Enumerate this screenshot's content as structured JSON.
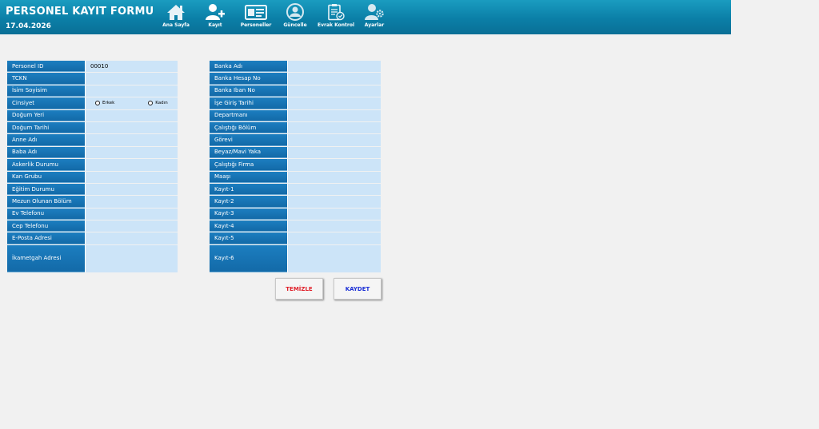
{
  "header": {
    "title": "PERSONEL KAYIT FORMU",
    "date": "17.04.2026",
    "nav": [
      {
        "label": "Ana Sayfa",
        "icon": "home-icon"
      },
      {
        "label": "Kayıt",
        "icon": "add-user-icon"
      },
      {
        "label": "Personeller",
        "icon": "id-card-icon"
      },
      {
        "label": "Güncelle",
        "icon": "user-refresh-icon"
      },
      {
        "label": "Evrak Kontrol",
        "icon": "clipboard-check-icon"
      },
      {
        "label": "Ayarlar",
        "icon": "user-settings-icon"
      }
    ]
  },
  "left_form": {
    "fields": [
      {
        "label": "Personel ID",
        "value": "00010"
      },
      {
        "label": "TCKN",
        "value": ""
      },
      {
        "label": "İsim Soyisim",
        "value": ""
      },
      {
        "label": "Cinsiyet",
        "value": ""
      },
      {
        "label": "Doğum Yeri",
        "value": ""
      },
      {
        "label": "Doğum Tarihi",
        "value": ""
      },
      {
        "label": "Anne Adı",
        "value": ""
      },
      {
        "label": "Baba Adı",
        "value": ""
      },
      {
        "label": "Askerlik Durumu",
        "value": ""
      },
      {
        "label": "Kan Grubu",
        "value": ""
      },
      {
        "label": "Eğitim Durumu",
        "value": ""
      },
      {
        "label": "Mezun Olunan Bölüm",
        "value": ""
      },
      {
        "label": "Ev Telefonu",
        "value": ""
      },
      {
        "label": "Cep Telefonu",
        "value": ""
      },
      {
        "label": "E-Posta Adresi",
        "value": ""
      },
      {
        "label": "İkametgah Adresi",
        "value": ""
      }
    ],
    "gender_options": [
      "Erkek",
      "Kadın"
    ]
  },
  "right_form": {
    "fields": [
      {
        "label": "Banka Adı",
        "value": ""
      },
      {
        "label": "Banka Hesap No",
        "value": ""
      },
      {
        "label": "Banka Iban No",
        "value": ""
      },
      {
        "label": "İşe Giriş Tarihi",
        "value": ""
      },
      {
        "label": "Departmanı",
        "value": ""
      },
      {
        "label": "Çalıştığı Bölüm",
        "value": ""
      },
      {
        "label": "Görevi",
        "value": ""
      },
      {
        "label": "Beyaz/Mavi Yaka",
        "value": ""
      },
      {
        "label": "Çalıştığı Firma",
        "value": ""
      },
      {
        "label": "Maaşı",
        "value": ""
      },
      {
        "label": "Kayıt-1",
        "value": ""
      },
      {
        "label": "Kayıt-2",
        "value": ""
      },
      {
        "label": "Kayıt-3",
        "value": ""
      },
      {
        "label": "Kayıt-4",
        "value": ""
      },
      {
        "label": "Kayıt-5",
        "value": ""
      },
      {
        "label": "Kayıt-6",
        "value": ""
      }
    ]
  },
  "buttons": {
    "clear_label": "TEMİZLE",
    "save_label": "KAYDET"
  },
  "colors": {
    "header": "#0b7fa7",
    "label_bg": "#1c7ec0",
    "value_bg": "#cce4f8",
    "clear_text": "#e0202a",
    "save_text": "#1b2fd6"
  }
}
